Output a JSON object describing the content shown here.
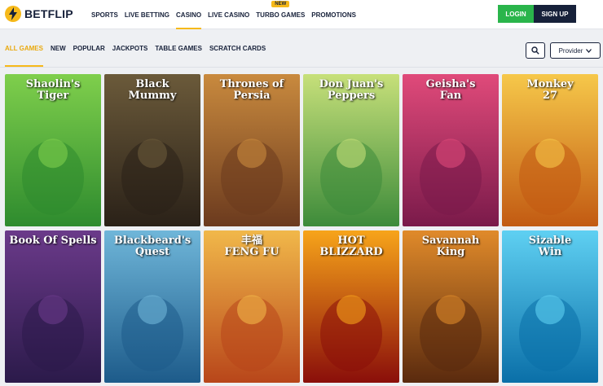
{
  "header": {
    "logo_text": "BETFLIP",
    "nav": [
      {
        "label": "SPORTS"
      },
      {
        "label": "LIVE BETTING"
      },
      {
        "label": "CASINO",
        "active": true
      },
      {
        "label": "LIVE CASINO"
      },
      {
        "label": "TURBO GAMES",
        "badge": "NEW"
      },
      {
        "label": "PROMOTIONS"
      }
    ],
    "login_label": "LOGIN",
    "signup_label": "SIGN UP"
  },
  "filters": {
    "tabs": [
      {
        "label": "ALL GAMES",
        "active": true
      },
      {
        "label": "NEW"
      },
      {
        "label": "POPULAR"
      },
      {
        "label": "JACKPOTS"
      },
      {
        "label": "TABLE GAMES"
      },
      {
        "label": "SCRATCH CARDS"
      }
    ],
    "search_icon": "search-icon",
    "provider_label": "Provider"
  },
  "games": [
    {
      "title": "Shaolin's Tiger",
      "line1": "Shaolin's",
      "line2": "Tiger",
      "bg": "#2e8b2e",
      "bg2": "#7fcf4c"
    },
    {
      "title": "Black Mummy",
      "line1": "Black",
      "line2": "Mummy",
      "bg": "#2a2118",
      "bg2": "#6b5a3a"
    },
    {
      "title": "Thrones of Persia",
      "line1": "Thrones of Persia",
      "line2": "",
      "bg": "#6b3a1e",
      "bg2": "#c98a3e"
    },
    {
      "title": "Don Juan's Peppers",
      "line1": "Don Juan's",
      "line2": "Peppers",
      "bg": "#3d8b3a",
      "bg2": "#c7e07a"
    },
    {
      "title": "Geisha's Fan",
      "line1": "Geisha's",
      "line2": "Fan",
      "bg": "#7a1a4a",
      "bg2": "#e04a7a"
    },
    {
      "title": "Monkey 27",
      "line1": "Monkey",
      "line2": "27",
      "bg": "#c25a12",
      "bg2": "#f6c84a"
    },
    {
      "title": "Book Of Spells",
      "line1": "Book Of Spells",
      "line2": "",
      "bg": "#2b1a4a",
      "bg2": "#6b3a8a"
    },
    {
      "title": "Blackbeard's Quest",
      "line1": "Blackbeard's Quest",
      "line2": "",
      "bg": "#1d5b8a",
      "bg2": "#6fb6d9"
    },
    {
      "title": "Feng Fu",
      "line1": "丰福",
      "line2": "FENG FU",
      "bg": "#b8461a",
      "bg2": "#f1b84a"
    },
    {
      "title": "Hot Blizzard",
      "line1": "HOT",
      "line2": "BLIZZARD",
      "bg": "#8a0e0a",
      "bg2": "#f7a41a"
    },
    {
      "title": "Savannah King",
      "line1": "Savannah",
      "line2": "King",
      "bg": "#5a2a0e",
      "bg2": "#e08a2a"
    },
    {
      "title": "Sizable Win",
      "line1": "Sizable",
      "line2": "Win",
      "bg": "#0a6fa8",
      "bg2": "#5fd0f2"
    }
  ]
}
